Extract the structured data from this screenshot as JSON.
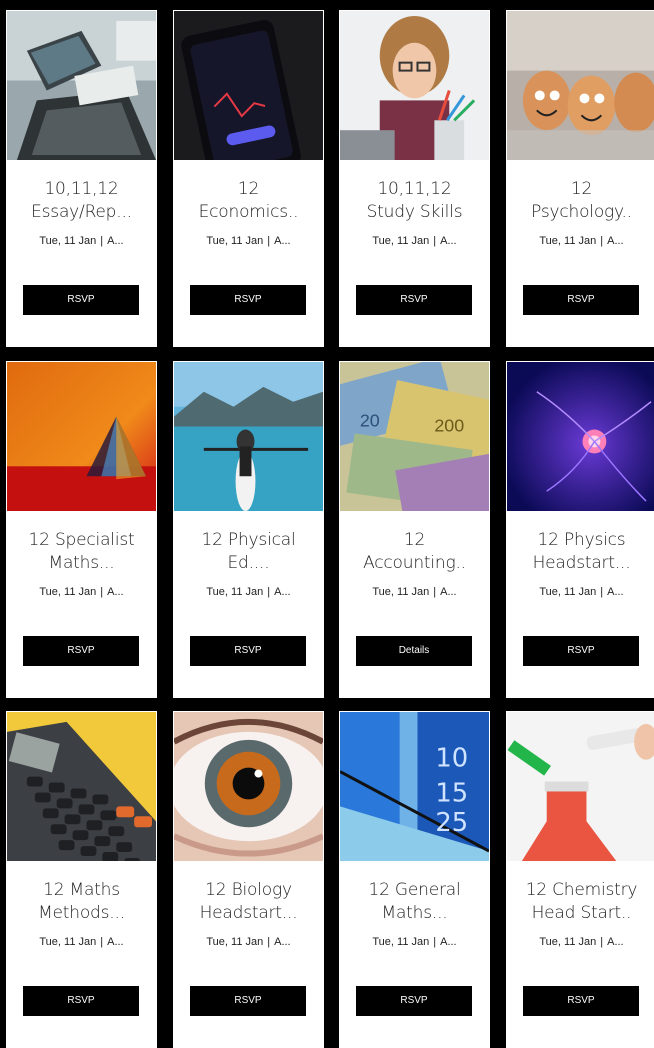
{
  "events": [
    {
      "title_l1": "10,11,12",
      "title_l2": "Essay/Rep...",
      "date": "Tue, 11 Jan",
      "venue": "A...",
      "button": "RSVP",
      "image": "laptop-desk-image"
    },
    {
      "title_l1": "12",
      "title_l2": "Economics..",
      "date": "Tue, 11 Jan",
      "venue": "A...",
      "button": "RSVP",
      "image": "stock-phone-image"
    },
    {
      "title_l1": "10,11,12",
      "title_l2": "Study Skills",
      "date": "Tue, 11 Jan",
      "venue": "A...",
      "button": "RSVP",
      "image": "student-pencils-image"
    },
    {
      "title_l1": "12",
      "title_l2": "Psychology..",
      "date": "Tue, 11 Jan",
      "venue": "A...",
      "button": "RSVP",
      "image": "egg-faces-image"
    },
    {
      "title_l1": "12 Specialist",
      "title_l2": "Maths...",
      "date": "Tue, 11 Jan",
      "venue": "A...",
      "button": "RSVP",
      "image": "prism-image"
    },
    {
      "title_l1": "12 Physical",
      "title_l2": "Ed....",
      "date": "Tue, 11 Jan",
      "venue": "A...",
      "button": "RSVP",
      "image": "kayak-lake-image"
    },
    {
      "title_l1": "12",
      "title_l2": "Accounting..",
      "date": "Tue, 11 Jan",
      "venue": "A...",
      "button": "Details",
      "image": "euro-notes-image"
    },
    {
      "title_l1": "12 Physics",
      "title_l2": "Headstart...",
      "date": "Tue, 11 Jan",
      "venue": "A...",
      "button": "RSVP",
      "image": "plasma-ball-image"
    },
    {
      "title_l1": "12 Maths",
      "title_l2": "Methods...",
      "date": "Tue, 11 Jan",
      "venue": "A...",
      "button": "RSVP",
      "image": "calculator-image"
    },
    {
      "title_l1": "12 Biology",
      "title_l2": "Headstart...",
      "date": "Tue, 11 Jan",
      "venue": "A...",
      "button": "RSVP",
      "image": "eye-closeup-image"
    },
    {
      "title_l1": "12 General",
      "title_l2": "Maths...",
      "date": "Tue, 11 Jan",
      "venue": "A...",
      "button": "RSVP",
      "image": "numbers-wall-image"
    },
    {
      "title_l1": "12 Chemistry",
      "title_l2": "Head Start..",
      "date": "Tue, 11 Jan",
      "venue": "A...",
      "button": "RSVP",
      "image": "chemistry-flask-image"
    }
  ],
  "wall_numbers": [
    "10",
    "15",
    "25"
  ]
}
